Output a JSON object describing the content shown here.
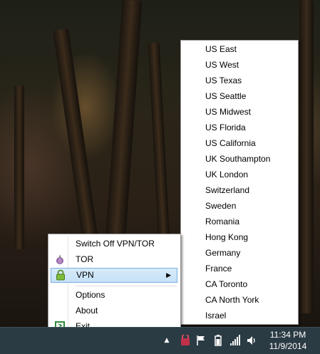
{
  "main_menu": {
    "items": [
      {
        "label": "Switch Off VPN/TOR",
        "icon": null
      },
      {
        "label": "TOR",
        "icon": "onion-icon"
      },
      {
        "label": "VPN",
        "icon": "green-lock-icon",
        "highlighted": true,
        "has_submenu": true
      },
      {
        "label": "Options",
        "icon": null
      },
      {
        "label": "About",
        "icon": null
      },
      {
        "label": "Exit",
        "icon": "exit-door-icon"
      }
    ]
  },
  "vpn_submenu": {
    "items": [
      "US East",
      "US West",
      "US Texas",
      "US Seattle",
      "US Midwest",
      "US Florida",
      "US California",
      "UK Southampton",
      "UK London",
      "Switzerland",
      "Sweden",
      "Romania",
      "Hong Kong",
      "Germany",
      "France",
      "CA Toronto",
      "CA North York",
      "Israel"
    ]
  },
  "taskbar": {
    "clock_time": "11:34 PM",
    "clock_date": "11/9/2014",
    "tray_icons": [
      "show-hidden-icons-arrow",
      "vpn-app-tray-icon",
      "action-center-flag-icon",
      "power-icon",
      "network-signal-icon",
      "volume-icon"
    ],
    "background": "#2b3b44"
  },
  "colors": {
    "highlight": "#c6e1f7",
    "highlight_border": "#7aaee0",
    "menu_border": "#979797"
  }
}
